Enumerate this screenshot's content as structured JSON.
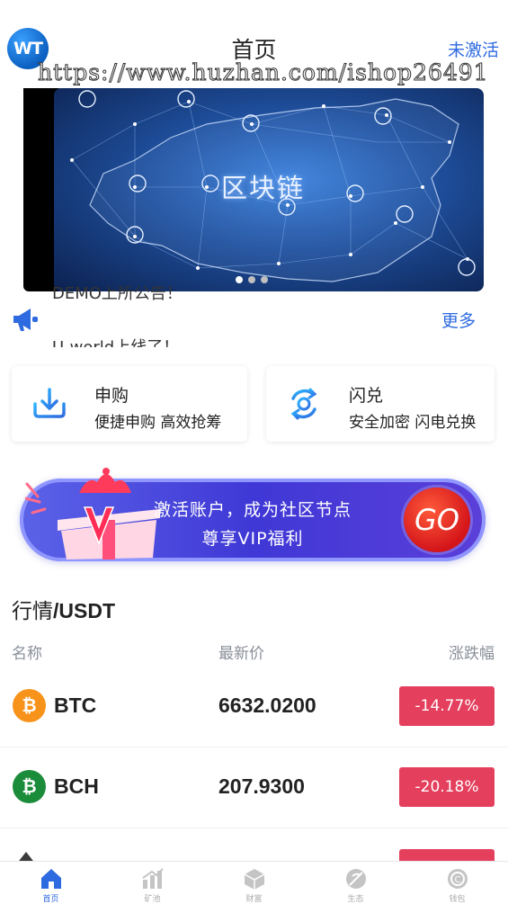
{
  "header": {
    "logo_text": "WT",
    "title": "首页",
    "status": "未激活",
    "watermark": "https://www.huzhan.com/ishop26491"
  },
  "banner": {
    "text": "区块链",
    "slide_count": 3,
    "active_slide": 1
  },
  "notice": {
    "lines": [
      "DEMO上所公告！",
      "U-world上线了！"
    ],
    "more": "更多",
    "icon": "megaphone-icon"
  },
  "quick_actions": [
    {
      "title": "申购",
      "subtitle": "便捷申购 高效抢筹",
      "icon": "download-tray-icon"
    },
    {
      "title": "闪兑",
      "subtitle": "安全加密 闪电兑换",
      "icon": "swap-refresh-icon"
    }
  ],
  "vip_banner": {
    "line1": "激活账户，成为社区节点",
    "line2": "尊享VIP福利",
    "go": "GO",
    "gift_letter": "V"
  },
  "market": {
    "title_prefix": "行情",
    "title_suffix": "/USDT",
    "headers": {
      "name": "名称",
      "price": "最新价",
      "change": "涨跌幅"
    },
    "rows": [
      {
        "symbol": "BTC",
        "icon_letter": "₿",
        "icon_color": "#f7931a",
        "price": "6632.0200",
        "change": "-14.77%"
      },
      {
        "symbol": "BCH",
        "icon_letter": "₿",
        "icon_color": "#1b8c3a",
        "price": "207.9300",
        "change": "-20.18%"
      }
    ]
  },
  "tabbar": [
    {
      "label": "首页",
      "icon": "home-icon",
      "active": true
    },
    {
      "label": "矿池",
      "icon": "chart-icon",
      "active": false
    },
    {
      "label": "财富",
      "icon": "cube-icon",
      "active": false
    },
    {
      "label": "生态",
      "icon": "leaf-icon",
      "active": false
    },
    {
      "label": "钱包",
      "icon": "coin-icon",
      "active": false
    }
  ],
  "colors": {
    "accent": "#2f6be0",
    "down": "#e43f5d",
    "vip": "#3f38d6",
    "go": "#d4151a"
  }
}
